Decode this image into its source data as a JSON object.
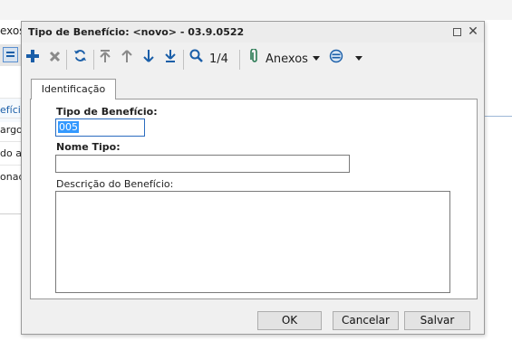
{
  "background": {
    "tab_label": "exos",
    "list_rows": [
      "efício",
      "argo",
      "do a",
      "onado"
    ]
  },
  "dialog": {
    "title": "Tipo de Benefício: <novo> - 03.9.0522",
    "toolbar": {
      "record_position": "1/4",
      "attachments_label": "Anexos"
    },
    "tab_label": "Identificação",
    "fields": {
      "tipo_beneficio_label": "Tipo de Benefício:",
      "tipo_beneficio_value": "005",
      "nome_tipo_label": "Nome Tipo:",
      "nome_tipo_value": "",
      "descricao_label": "Descrição do Benefício:",
      "descricao_value": ""
    },
    "buttons": {
      "ok": "OK",
      "cancel": "Cancelar",
      "save": "Salvar"
    }
  },
  "colors": {
    "accent_blue": "#1a5ea8",
    "selection": "#3399ff",
    "attachment_icon": "#2b7a54"
  }
}
